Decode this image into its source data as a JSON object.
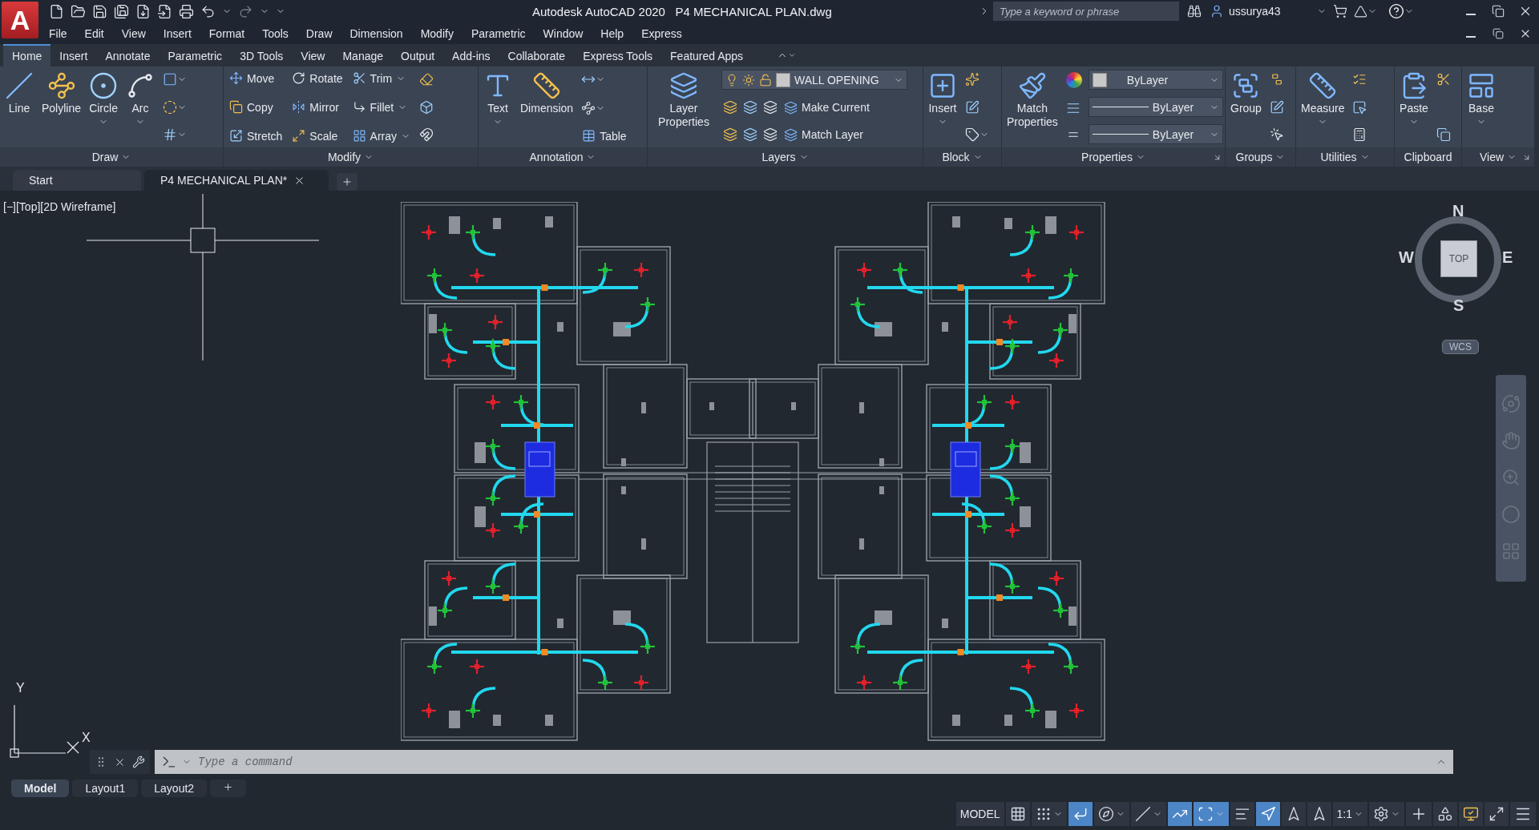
{
  "title_bar": {
    "app_logo": "A",
    "app_title": "Autodesk AutoCAD 2020",
    "file_name": "P4 MECHANICAL PLAN.dwg",
    "search": {
      "placeholder": "Type a keyword or phrase"
    },
    "user": "ussurya43"
  },
  "menu_bar": [
    "File",
    "Edit",
    "View",
    "Insert",
    "Format",
    "Tools",
    "Draw",
    "Dimension",
    "Modify",
    "Parametric",
    "Window",
    "Help",
    "Express"
  ],
  "ribbon_tabs": [
    {
      "label": "Home",
      "selected": true
    },
    {
      "label": "Insert",
      "selected": false
    },
    {
      "label": "Annotate",
      "selected": false
    },
    {
      "label": "Parametric",
      "selected": false
    },
    {
      "label": "3D Tools",
      "selected": false
    },
    {
      "label": "View",
      "selected": false
    },
    {
      "label": "Manage",
      "selected": false
    },
    {
      "label": "Output",
      "selected": false
    },
    {
      "label": "Add-ins",
      "selected": false
    },
    {
      "label": "Collaborate",
      "selected": false
    },
    {
      "label": "Express Tools",
      "selected": false
    },
    {
      "label": "Featured Apps",
      "selected": false
    }
  ],
  "ribbon_panels": [
    {
      "title": "Draw",
      "menu": true,
      "launcher": false,
      "columns": [
        [
          [
            {
              "kind": "large",
              "label": "Line",
              "menu": false
            }
          ]
        ],
        [
          [
            {
              "kind": "large",
              "label": "Polyline",
              "menu": false
            }
          ]
        ],
        [
          [
            {
              "kind": "large",
              "label": "Circle",
              "menu": true
            }
          ]
        ],
        [
          [
            {
              "kind": "large",
              "label": "Arc",
              "menu": true
            }
          ]
        ],
        [
          [
            {
              "kind": "icon",
              "menu": true
            }
          ],
          [
            {
              "kind": "icon",
              "menu": true
            }
          ],
          [
            {
              "kind": "icon",
              "menu": true
            }
          ]
        ]
      ]
    },
    {
      "title": "Modify",
      "menu": true,
      "launcher": false,
      "columns": [
        [
          [
            {
              "kind": "small",
              "label": "Move",
              "menu": false
            }
          ],
          [
            {
              "kind": "small",
              "label": "Copy",
              "menu": false
            }
          ],
          [
            {
              "kind": "small",
              "label": "Stretch",
              "menu": false
            }
          ]
        ],
        [
          [
            {
              "kind": "small",
              "label": "Rotate",
              "menu": false
            }
          ],
          [
            {
              "kind": "small",
              "label": "Mirror",
              "menu": false
            }
          ],
          [
            {
              "kind": "small",
              "label": "Scale",
              "menu": false
            }
          ]
        ],
        [
          [
            {
              "kind": "small",
              "label": "Trim",
              "menu": true
            }
          ],
          [
            {
              "kind": "small",
              "label": "Fillet",
              "menu": true
            }
          ],
          [
            {
              "kind": "small",
              "label": "Array",
              "menu": true
            }
          ]
        ],
        [
          [
            {
              "kind": "icon",
              "menu": false
            }
          ],
          [
            {
              "kind": "icon",
              "menu": false
            }
          ],
          [
            {
              "kind": "icon",
              "menu": false
            }
          ]
        ]
      ]
    },
    {
      "title": "Annotation",
      "menu": true,
      "launcher": false,
      "columns": [
        [
          [
            {
              "kind": "large",
              "label": "Text",
              "menu": true
            }
          ]
        ],
        [
          [
            {
              "kind": "large",
              "label": "Dimension",
              "menu": false
            }
          ]
        ],
        [
          [
            {
              "kind": "icon",
              "menu": true
            }
          ],
          [
            {
              "kind": "icon",
              "menu": true
            }
          ],
          [
            {
              "kind": "small",
              "label": "Table",
              "menu": false
            }
          ]
        ]
      ]
    },
    {
      "title": "Layers",
      "menu": true,
      "launcher": false,
      "columns": [
        [
          [
            {
              "kind": "large",
              "label": "Layer Properties",
              "menu": false
            }
          ]
        ],
        [
          [
            {
              "kind": "layer_dropdown",
              "value": "WALL OPENING"
            }
          ],
          [
            {
              "kind": "icon",
              "menu": false
            },
            {
              "kind": "icon",
              "menu": false
            },
            {
              "kind": "icon",
              "menu": false
            },
            {
              "kind": "small",
              "label": "Make Current",
              "menu": false
            }
          ],
          [
            {
              "kind": "icon",
              "menu": false
            },
            {
              "kind": "icon",
              "menu": false
            },
            {
              "kind": "icon",
              "menu": false
            },
            {
              "kind": "small",
              "label": "Match Layer",
              "menu": false
            }
          ]
        ]
      ]
    },
    {
      "title": "Block",
      "menu": true,
      "launcher": false,
      "columns": [
        [
          [
            {
              "kind": "large",
              "label": "Insert",
              "menu": true
            }
          ]
        ],
        [
          [
            {
              "kind": "icon",
              "menu": false
            }
          ],
          [
            {
              "kind": "icon",
              "menu": false
            }
          ],
          [
            {
              "kind": "icon",
              "menu": true
            }
          ]
        ]
      ]
    },
    {
      "title": "Properties",
      "menu": true,
      "launcher": true,
      "columns": [
        [
          [
            {
              "kind": "large",
              "label": "Match Properties",
              "menu": false
            }
          ]
        ],
        [
          [
            {
              "kind": "icon",
              "menu": false
            }
          ],
          [
            {
              "kind": "icon",
              "menu": false
            }
          ],
          [
            {
              "kind": "icon",
              "menu": false
            }
          ]
        ],
        [
          [
            {
              "kind": "color_dropdown",
              "value": "ByLayer"
            }
          ],
          [
            {
              "kind": "line_dropdown",
              "value": "ByLayer"
            }
          ],
          [
            {
              "kind": "line_dropdown",
              "value": "ByLayer"
            }
          ]
        ]
      ]
    },
    {
      "title": "Groups",
      "menu": true,
      "launcher": false,
      "columns": [
        [
          [
            {
              "kind": "large",
              "label": "Group",
              "menu": false
            }
          ]
        ],
        [
          [
            {
              "kind": "icon",
              "menu": false
            }
          ],
          [
            {
              "kind": "icon",
              "menu": false
            }
          ],
          [
            {
              "kind": "icon",
              "menu": false
            }
          ]
        ]
      ]
    },
    {
      "title": "Utilities",
      "menu": true,
      "launcher": false,
      "columns": [
        [
          [
            {
              "kind": "large",
              "label": "Measure",
              "menu": true
            }
          ]
        ],
        [
          [
            {
              "kind": "icon",
              "menu": false
            }
          ],
          [
            {
              "kind": "icon",
              "menu": false
            }
          ],
          [
            {
              "kind": "icon",
              "menu": false
            }
          ]
        ]
      ]
    },
    {
      "title": "Clipboard",
      "menu": false,
      "launcher": false,
      "columns": [
        [
          [
            {
              "kind": "large",
              "label": "Paste",
              "menu": true
            }
          ]
        ],
        [
          [
            {
              "kind": "icon",
              "menu": false
            }
          ],
          [
            {
              "kind": "icon",
              "menu": false
            }
          ]
        ]
      ]
    },
    {
      "title": "View",
      "menu": true,
      "launcher": true,
      "columns": [
        [
          [
            {
              "kind": "large",
              "label": "Base",
              "menu": true
            }
          ]
        ]
      ]
    }
  ],
  "file_tabs": [
    {
      "label": "Start",
      "selected": false
    },
    {
      "label": "P4 MECHANICAL PLAN*",
      "selected": true
    }
  ],
  "viewport": {
    "label": "[−][Top][2D Wireframe]",
    "viewcube": {
      "north": "N",
      "south": "S",
      "east": "E",
      "west": "W",
      "face": "TOP",
      "ucs": "WCS"
    },
    "ucs_icon": {
      "y": "Y",
      "x": "X"
    }
  },
  "command_line": {
    "placeholder": "Type a command"
  },
  "layout_tabs": [
    {
      "label": "Model",
      "selected": true
    },
    {
      "label": "Layout1",
      "selected": false
    },
    {
      "label": "Layout2",
      "selected": false
    }
  ],
  "status_bar": {
    "space": "MODEL",
    "scale": "1:1",
    "toggles": [
      {
        "on": false
      },
      {
        "on": false
      },
      {
        "on": true
      },
      {
        "on": false
      },
      {
        "on": false
      },
      {
        "on": true
      },
      {
        "on": true
      },
      {
        "on": false
      },
      {
        "on": true
      },
      {
        "on": false
      },
      {
        "on": false
      }
    ]
  }
}
